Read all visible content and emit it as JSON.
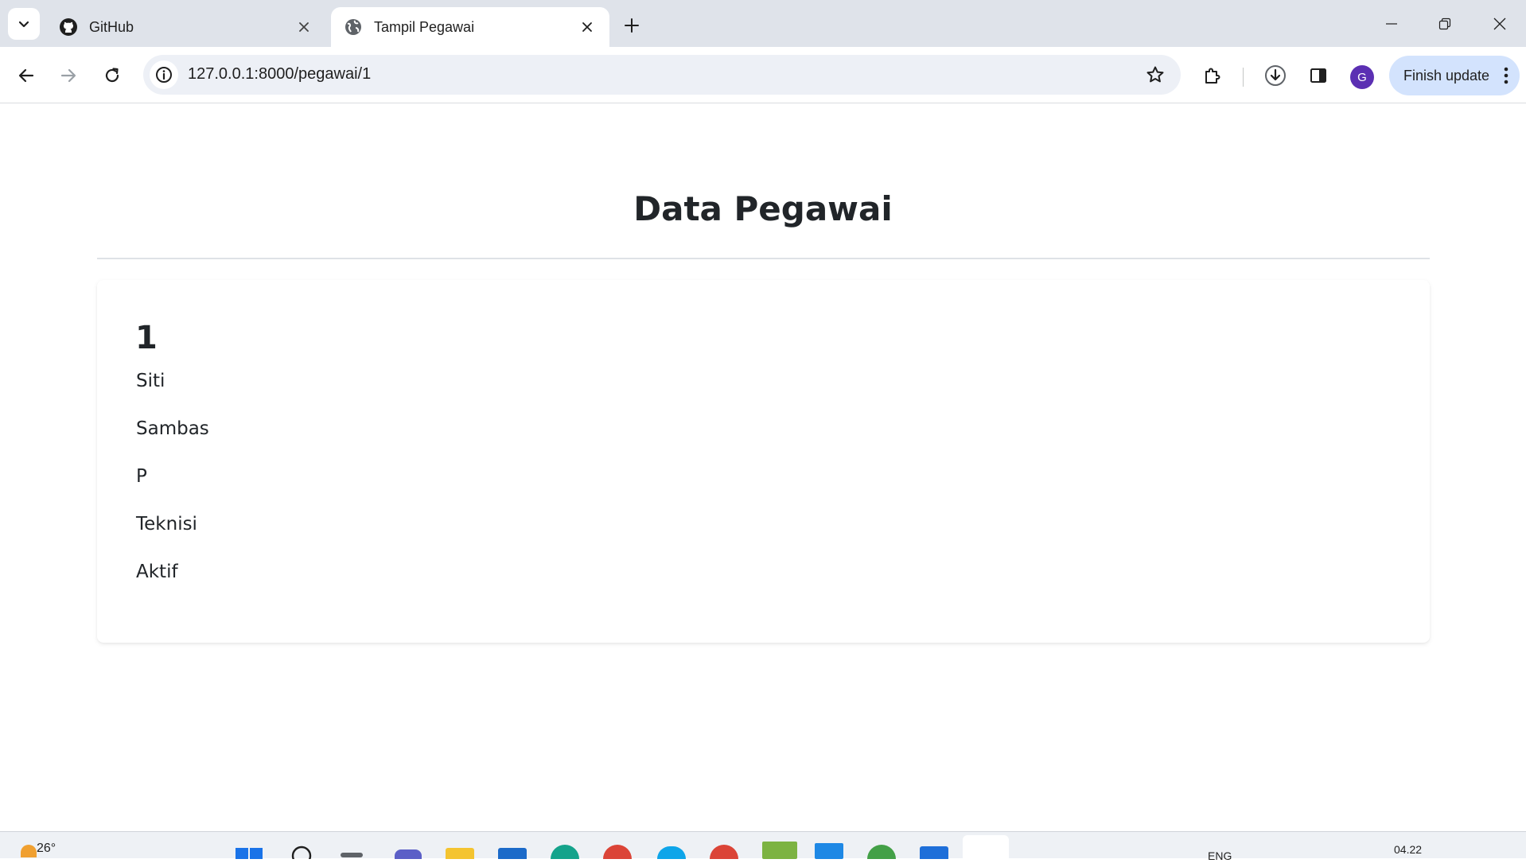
{
  "browser": {
    "tabs": [
      {
        "title": "GitHub",
        "favicon": "github-icon",
        "active": false
      },
      {
        "title": "Tampil Pegawai",
        "favicon": "globe-icon",
        "active": true
      }
    ],
    "url": "127.0.0.1:8000/pegawai/1",
    "profile_initial": "G",
    "finish_update_label": "Finish update"
  },
  "page": {
    "title": "Data Pegawai",
    "employee": {
      "id": "1",
      "first_name": "Siti",
      "last_name": "Sambas",
      "gender": "P",
      "position": "Teknisi",
      "status": "Aktif"
    }
  },
  "taskbar": {
    "weather_temp": "26°",
    "language": "ENG",
    "time": "04.22"
  },
  "colors": {
    "tabstrip_bg": "#dfe3ea",
    "omnibox_bg": "#edf0f6",
    "finish_update_bg": "#d3e3fd",
    "avatar_bg": "#5b2fb3",
    "text_dark": "#212529"
  }
}
